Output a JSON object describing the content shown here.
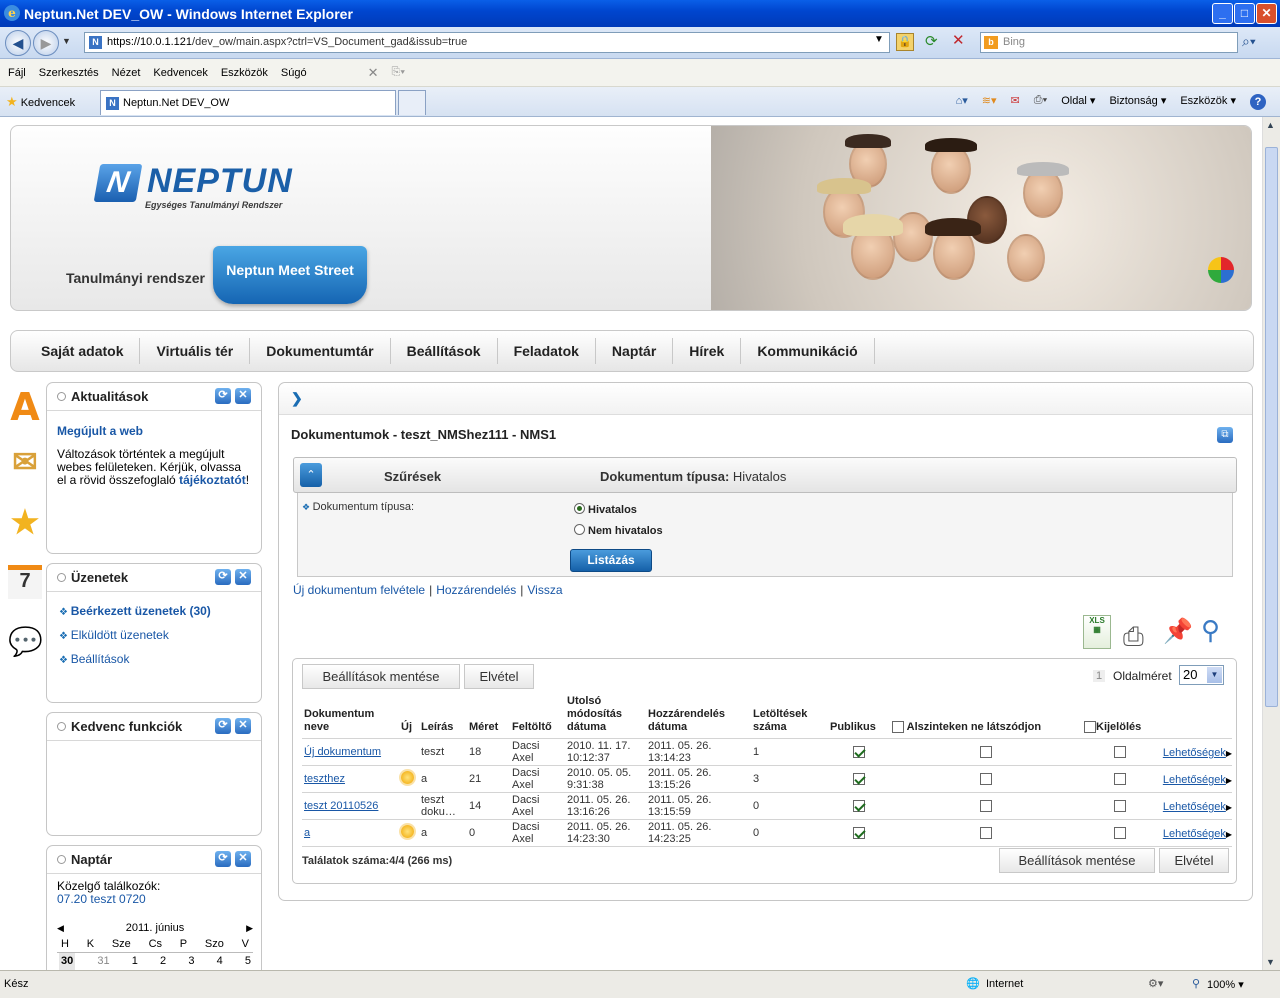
{
  "window": {
    "title": "Neptun.Net DEV_OW - Windows Internet Explorer",
    "min": "_",
    "max": "□",
    "close": "✕"
  },
  "address": {
    "scheme": "https://",
    "host": "10.0.1.121",
    "path": "/dev_ow/main.aspx?ctrl=VS_Document_gad&issub=true",
    "search_placeholder": "Bing"
  },
  "menubar": [
    "Fájl",
    "Szerkesztés",
    "Nézet",
    "Kedvencek",
    "Eszközök",
    "Súgó"
  ],
  "tabs": {
    "favorites": "Kedvencek",
    "active_tab": "Neptun.Net DEV_OW"
  },
  "commandbar": [
    "Oldal",
    "Biztonság",
    "Eszközök"
  ],
  "status": {
    "left": "Kész",
    "zone": "Internet",
    "zoom": "100%"
  },
  "header": {
    "logo_mark": "N",
    "logo_name": "NEPTUN",
    "logo_sub": "Egységes Tanulmányi Rendszer",
    "tab_system": "Tanulmányi rendszer",
    "tab_meet": "Neptun Meet Street"
  },
  "mainnav": [
    "Saját adatok",
    "Virtuális tér",
    "Dokumentumtár",
    "Beállítások",
    "Feladatok",
    "Naptár",
    "Hírek",
    "Kommunikáció"
  ],
  "panels": {
    "news": {
      "title": "Aktualitások",
      "headline": "Megújult a web",
      "text": "Változások történtek a megújult webes felületeken. Kérjük, olvassa el a rövid összefoglaló",
      "link": "tájékoztatót",
      "tail": "!"
    },
    "messages": {
      "title": "Üzenetek",
      "items": [
        "Beérkezett üzenetek (30)",
        "Elküldött üzenetek",
        "Beállítások"
      ]
    },
    "favorites": {
      "title": "Kedvenc funkciók"
    },
    "calendar": {
      "title": "Naptár",
      "upcoming_label": "Közelgő találkozók:",
      "upcoming": "07.20 teszt 0720",
      "month": "2011. június",
      "weekdays": [
        "H",
        "K",
        "Sze",
        "Cs",
        "P",
        "Szo",
        "V"
      ],
      "days": [
        "30",
        "31",
        "1",
        "2",
        "3",
        "4",
        "5"
      ]
    }
  },
  "content": {
    "title": "Dokumentumok - teszt_NMShez111 - NMS1",
    "filter": {
      "header": "Szűrések",
      "summary_label": "Dokumentum típusa:",
      "summary_value": "Hivatalos",
      "field_label": "Dokumentum típusa:",
      "options": [
        "Hivatalos",
        "Nem hivatalos"
      ],
      "selected": "Hivatalos",
      "button": "Listázás"
    },
    "actions": [
      "Új dokumentum felvétele",
      "Hozzárendelés",
      "Vissza"
    ],
    "grid": {
      "save_settings": "Beállítások mentése",
      "discard": "Elvétel",
      "page_number": "1",
      "page_size_label": "Oldalméret",
      "page_size": "20",
      "columns": [
        "Dokumentum neve",
        "Új",
        "Leírás",
        "Méret",
        "Feltöltő",
        "Utolsó módosítás dátuma",
        "Hozzárendelés dátuma",
        "Letöltések száma",
        "Publikus",
        "Alszinteken ne látszódjon",
        "Kijelölés"
      ],
      "rows": [
        {
          "name": "Új dokumentum",
          "new": false,
          "desc": "teszt",
          "size": "18",
          "uploader": "Dacsi Axel",
          "modified": "2010. 11. 17. 10:12:37",
          "assigned": "2011. 05. 26. 13:14:23",
          "downloads": "1",
          "public": true,
          "hide_sub": false,
          "select": false,
          "options": "Lehetőségek"
        },
        {
          "name": "teszthez",
          "new": true,
          "desc": "a",
          "size": "21",
          "uploader": "Dacsi Axel",
          "modified": "2010. 05. 05. 9:31:38",
          "assigned": "2011. 05. 26. 13:15:26",
          "downloads": "3",
          "public": true,
          "hide_sub": false,
          "select": false,
          "options": "Lehetőségek"
        },
        {
          "name": "teszt 20110526",
          "new": false,
          "desc": "teszt doku…",
          "size": "14",
          "uploader": "Dacsi Axel",
          "modified": "2011. 05. 26. 13:16:26",
          "assigned": "2011. 05. 26. 13:15:59",
          "downloads": "0",
          "public": true,
          "hide_sub": false,
          "select": false,
          "options": "Lehetőségek"
        },
        {
          "name": "a",
          "new": true,
          "desc": "a",
          "size": "0",
          "uploader": "Dacsi Axel",
          "modified": "2011. 05. 26. 14:23:30",
          "assigned": "2011. 05. 26. 14:23:25",
          "downloads": "0",
          "public": true,
          "hide_sub": false,
          "select": false,
          "options": "Lehetőségek"
        }
      ],
      "result_count": "Találatok száma:4/4 (266 ms)"
    }
  }
}
